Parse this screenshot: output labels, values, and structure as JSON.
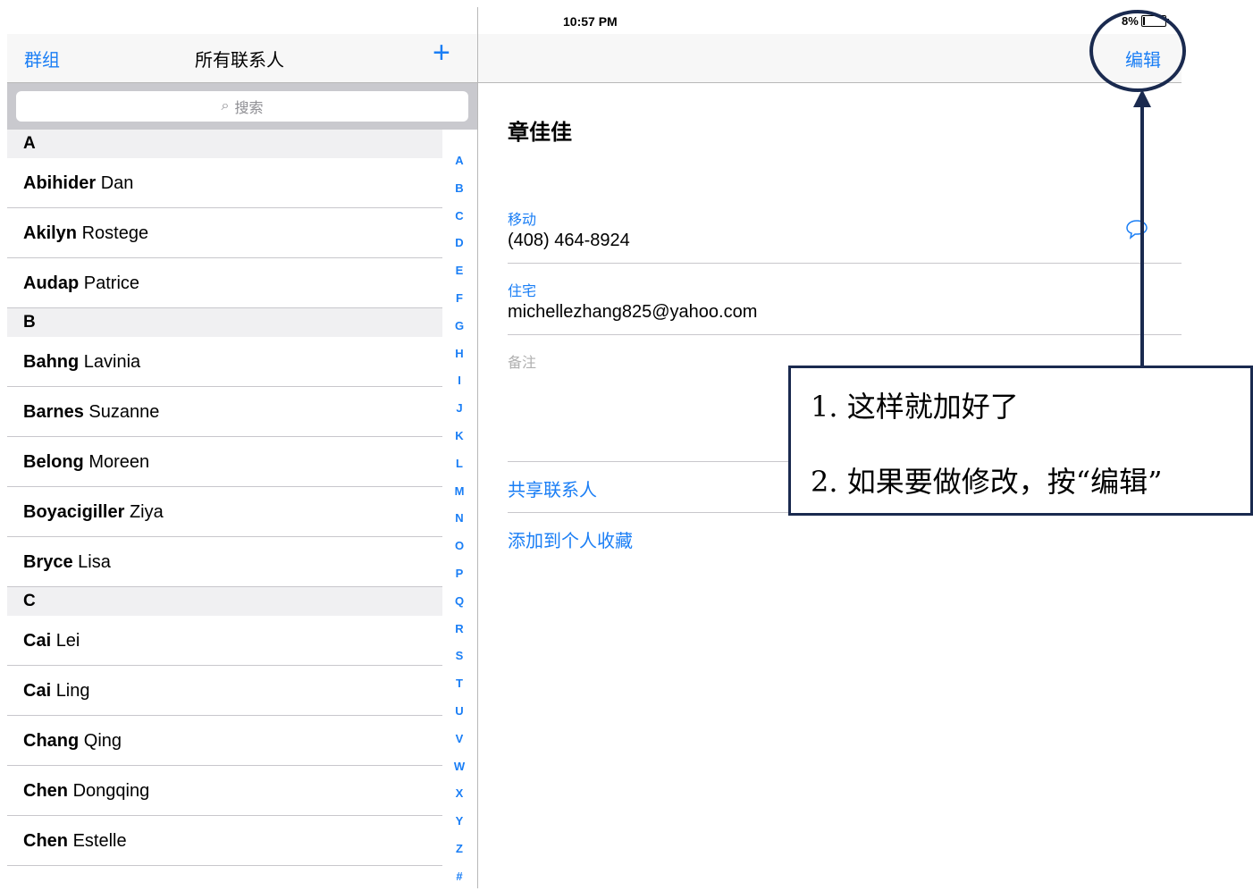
{
  "status": {
    "device": "iPad",
    "time": "10:57 PM",
    "battery": "8%",
    "battery_level": 0.08
  },
  "left_nav": {
    "groups": "群组",
    "title": "所有联系人",
    "add": "+"
  },
  "search": {
    "placeholder": "搜索"
  },
  "sections": [
    {
      "letter": "A",
      "contacts": [
        {
          "last": "Abihider",
          "first": "Dan"
        },
        {
          "last": "Akilyn",
          "first": "Rostege"
        },
        {
          "last": "Audap",
          "first": "Patrice"
        }
      ]
    },
    {
      "letter": "B",
      "contacts": [
        {
          "last": "Bahng",
          "first": "Lavinia"
        },
        {
          "last": "Barnes",
          "first": "Suzanne"
        },
        {
          "last": "Belong",
          "first": "Moreen"
        },
        {
          "last": "Boyacigiller",
          "first": "Ziya"
        },
        {
          "last": "Bryce",
          "first": "Lisa"
        }
      ]
    },
    {
      "letter": "C",
      "contacts": [
        {
          "last": "Cai",
          "first": "Lei"
        },
        {
          "last": "Cai",
          "first": "Ling"
        },
        {
          "last": "Chang",
          "first": "Qing"
        },
        {
          "last": "Chen",
          "first": "Dongqing"
        },
        {
          "last": "Chen",
          "first": "Estelle"
        }
      ]
    }
  ],
  "index": [
    "A",
    "B",
    "C",
    "D",
    "E",
    "F",
    "G",
    "H",
    "I",
    "J",
    "K",
    "L",
    "M",
    "N",
    "O",
    "P",
    "Q",
    "R",
    "S",
    "T",
    "U",
    "V",
    "W",
    "X",
    "Y",
    "Z",
    "#"
  ],
  "detail": {
    "edit": "编辑",
    "name": "章佳佳",
    "mobile_label": "移动",
    "mobile": "(408) 464-8924",
    "home_label": "住宅",
    "email": "michellezhang825@yahoo.com",
    "notes_label": "备注",
    "share": "共享联系人",
    "favorite": "添加到个人收藏"
  },
  "annotation": {
    "line1": "1. 这样就加好了",
    "line2": "2. 如果要做修改，按“编辑”"
  },
  "colors": {
    "accent": "#1a7ef5",
    "annotation": "#1a2a4f"
  }
}
